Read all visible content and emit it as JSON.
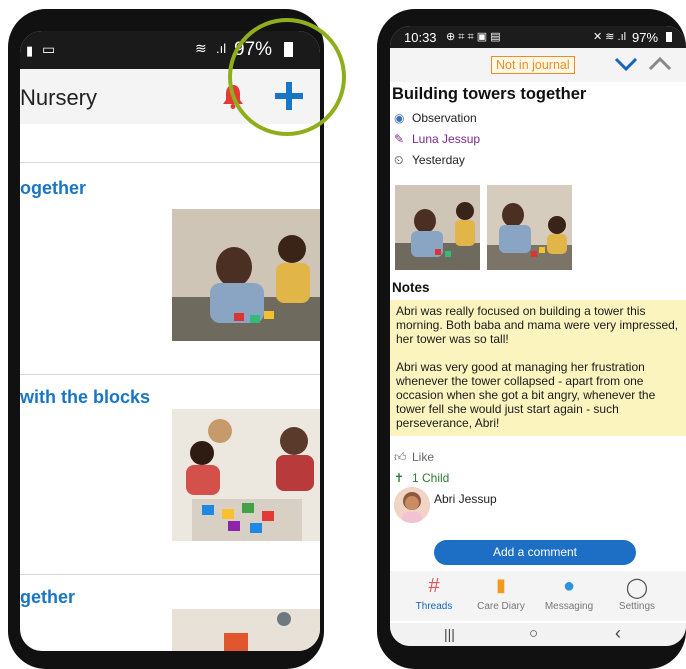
{
  "left_screen": {
    "status": {
      "battery": "97%"
    },
    "app_title": "Nursery",
    "feed": [
      {
        "title": "ogether"
      },
      {
        "title": "with the blocks"
      },
      {
        "title": "gether"
      }
    ]
  },
  "right_screen": {
    "status": {
      "time": "10:33",
      "battery": "97%"
    },
    "journal_badge": "Not in journal",
    "post": {
      "title": "Building towers together",
      "type": "Observation",
      "author": "Luna Jessup",
      "date": "Yesterday"
    },
    "notes_heading": "Notes",
    "notes_p1": "Abri was really focused on building a tower this morning. Both baba and mama were very impressed, her tower was so tall!",
    "notes_p2": "Abri was very good at managing her frustration whenever the tower collapsed - apart from one occasion when she got a bit angry, whenever the tower fell she would just start again - such perseverance, Abri!",
    "like_label": "Like",
    "child_count_label": "1 Child",
    "child_name": "Abri Jessup",
    "add_comment_label": "Add a comment",
    "nav": [
      {
        "label": "Threads",
        "icon": "threads-icon"
      },
      {
        "label": "Care Diary",
        "icon": "care-diary-icon"
      },
      {
        "label": "Messaging",
        "icon": "messaging-icon"
      },
      {
        "label": "Settings",
        "icon": "settings-icon"
      }
    ],
    "system_nav": {
      "recents": "|||",
      "home": "○",
      "back": "‹"
    }
  },
  "colors": {
    "accent_blue": "#1976c6",
    "highlight_ring": "#8fae1b",
    "badge_orange": "#f08a2a",
    "notes_bg": "#fbf4bf"
  }
}
